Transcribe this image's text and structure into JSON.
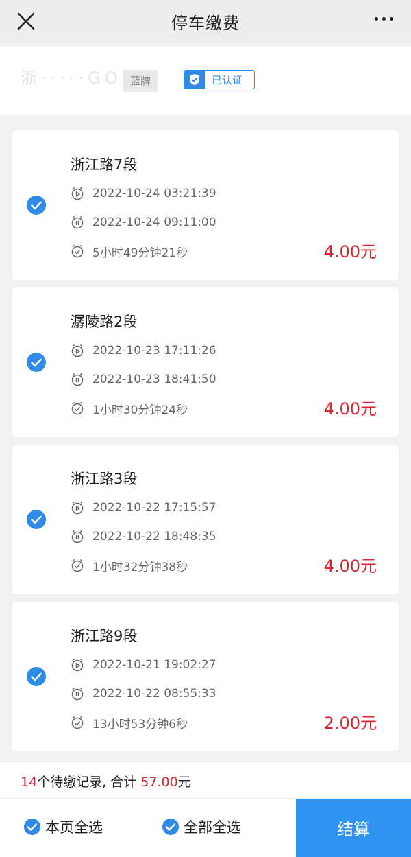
{
  "header": {
    "title": "停车缴费",
    "close_icon": "close-icon",
    "more_icon": "more-icon"
  },
  "plate": {
    "number": "浙·····GO",
    "type": "蓝牌",
    "verified_label": "已认证",
    "accent": "#2f8be6"
  },
  "records": [
    {
      "road": "浙江路7段",
      "start": "2022-10-24 03:21:39",
      "end": "2022-10-24 09:11:00",
      "duration": "5小时49分钟21秒",
      "amount": "4.00元",
      "checked": true
    },
    {
      "road": "潺陵路2段",
      "start": "2022-10-23 17:11:26",
      "end": "2022-10-23 18:41:50",
      "duration": "1小时30分钟24秒",
      "amount": "4.00元",
      "checked": true
    },
    {
      "road": "浙江路3段",
      "start": "2022-10-22 17:15:57",
      "end": "2022-10-22 18:48:35",
      "duration": "1小时32分钟38秒",
      "amount": "4.00元",
      "checked": true
    },
    {
      "road": "浙江路9段",
      "start": "2022-10-21 19:02:27",
      "end": "2022-10-22 08:55:33",
      "duration": "13小时53分钟6秒",
      "amount": "2.00元",
      "checked": true
    }
  ],
  "summary": {
    "count": "14",
    "count_suffix": "个待缴记录, 合计 ",
    "total": "57.00",
    "total_suffix": "元"
  },
  "footer": {
    "select_page_label": "本页全选",
    "select_all_label": "全部全选",
    "pay_label": "结算"
  },
  "colors": {
    "accent": "#2f93f0",
    "amount": "#d9232e"
  }
}
